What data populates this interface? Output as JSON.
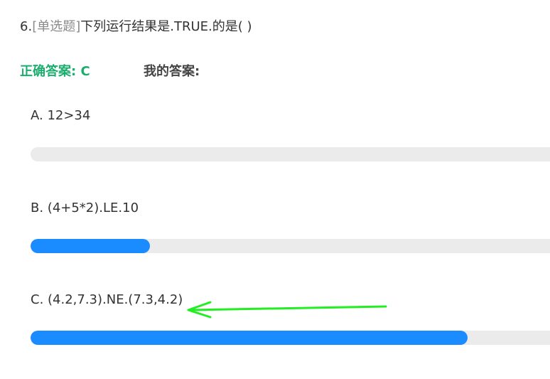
{
  "question": {
    "number": "6.",
    "type": "[单选题]",
    "text": "下列运行结果是.TRUE.的是( )"
  },
  "answer": {
    "correct": "正确答案: C",
    "mine": "我的答案:"
  },
  "options": [
    {
      "text": "A.  12>34",
      "percent": 0
    },
    {
      "text": "B.  (4+5*2).LE.10",
      "percent": 22.5
    },
    {
      "text": "C.  (4.2,7.3).NE.(7.3,4.2)",
      "percent": 82.5
    }
  ],
  "colors": {
    "correct": "#1aad6e",
    "bar_fill": "#1a8cff",
    "bar_track": "#ebebeb",
    "annotation_arrow": "#22ee22"
  },
  "annotation": {
    "icon": "arrow-icon",
    "points_to": "C"
  }
}
